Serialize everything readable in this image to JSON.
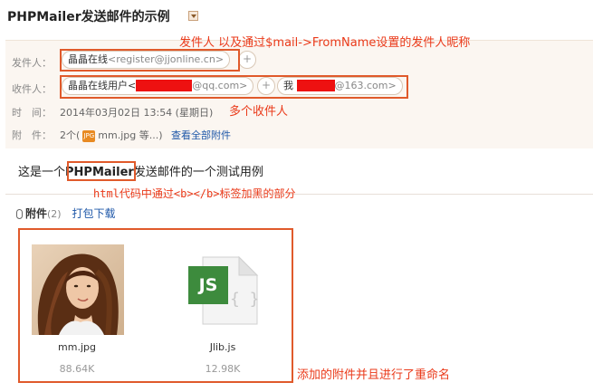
{
  "mail": {
    "subject": "PHPMailer发送邮件的示例",
    "from_label": "发件人：",
    "from_name": "晶晶在线",
    "from_addr": "<register@jjonline.cn>",
    "to_label": "收件人：",
    "to1_name": "晶晶在线用户<",
    "to1_addr_tail": "@qq.com>",
    "to2_name": "我",
    "to2_addr_tail": "@163.com>",
    "plus": "+",
    "time_label": "时　间：",
    "time_value": "2014年03月02日 13:54 (星期日)",
    "attach_label": "附　件：",
    "attach_count": "2个(",
    "attach_preview": "mm.jpg 等...)",
    "attach_view_all": "查看全部附件",
    "jpg_badge": "JPG",
    "body_prefix": "这是一个",
    "body_bold": "PHPMailer",
    "body_suffix": "发送邮件的一个测试用例",
    "attachments_title": "附件",
    "attachments_count": "(2)",
    "download_all": "打包下载"
  },
  "files": [
    {
      "name": "mm.jpg",
      "size": "88.64K",
      "icon": "photo-thumbnail"
    },
    {
      "name": "Jlib.js",
      "size": "12.98K",
      "icon": "js-file-icon",
      "badge": "JS"
    }
  ],
  "annotations": {
    "sender": "发件人 以及通过$mail->FromName设置的发件人昵称",
    "recipients": "多个收件人",
    "bold": "html代码中通过<b></b>标签加黑的部分",
    "attachments": "添加的附件并且进行了重命名"
  },
  "colors": {
    "annotation": "#ea3a1a",
    "link": "#1e57a8",
    "redaction": "#ee1111"
  }
}
